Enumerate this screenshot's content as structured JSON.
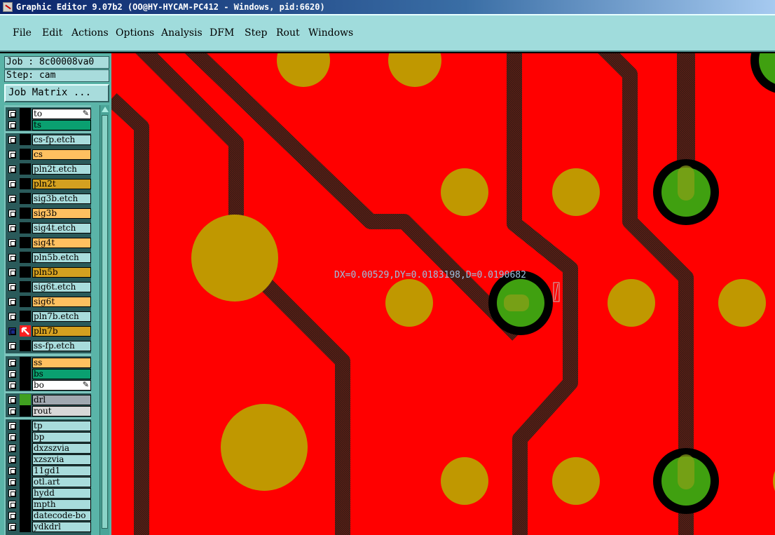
{
  "window": {
    "title": "Graphic Editor 9.07b2 (OO@HY-HYCAM-PC412 - Windows, pid:6620)"
  },
  "menu": [
    "File",
    "Edit",
    "Actions",
    "Options",
    "Analysis",
    "DFM",
    "Step",
    "Rout",
    "Windows"
  ],
  "panel": {
    "job": "Job : 8c00008va0",
    "step": "Step: cam",
    "job_matrix": "Job Matrix ..."
  },
  "layers": [
    {
      "name": "to",
      "color": "#ffffff",
      "swatch": "#000000",
      "editable_icon": true
    },
    {
      "name": "ts",
      "color": "#0aa070",
      "swatch": "#000000"
    },
    {
      "name": "cs-fp.etch",
      "color": "#a8dcdc",
      "swatch": "#000000"
    },
    {
      "name": "cs",
      "color": "#ffc060",
      "swatch": "#000000"
    },
    {
      "name": "pln2t.etch",
      "color": "#a8dcdc",
      "swatch": "#000000"
    },
    {
      "name": "pln2t",
      "color": "#d4a020",
      "swatch": "#000000"
    },
    {
      "name": "sig3b.etch",
      "color": "#a8dcdc",
      "swatch": "#000000"
    },
    {
      "name": "sig3b",
      "color": "#ffc060",
      "swatch": "#000000"
    },
    {
      "name": "sig4t.etch",
      "color": "#a8dcdc",
      "swatch": "#000000"
    },
    {
      "name": "sig4t",
      "color": "#ffc060",
      "swatch": "#000000"
    },
    {
      "name": "pln5b.etch",
      "color": "#a8dcdc",
      "swatch": "#000000"
    },
    {
      "name": "pln5b",
      "color": "#d4a020",
      "swatch": "#000000"
    },
    {
      "name": "sig6t.etch",
      "color": "#a8dcdc",
      "swatch": "#000000"
    },
    {
      "name": "sig6t",
      "color": "#ffc060",
      "swatch": "#000000"
    },
    {
      "name": "pln7b.etch",
      "color": "#a8dcdc",
      "swatch": "#000000"
    },
    {
      "name": "pln7b",
      "color": "#d4a020",
      "swatch": "#000000",
      "active": true
    },
    {
      "name": "ss-fp.etch",
      "color": "#a8dcdc",
      "swatch": "#000000"
    },
    {
      "name": "ss",
      "color": "#ffc060",
      "swatch": "#000000"
    },
    {
      "name": "bs",
      "color": "#0aa070",
      "swatch": "#000000"
    },
    {
      "name": "bo",
      "color": "#ffffff",
      "swatch": "#000000",
      "editable_icon": true
    },
    {
      "name": "drl",
      "color": "#a0a8b0",
      "swatch": "#40a020"
    },
    {
      "name": "rout",
      "color": "#d8d8d8",
      "swatch": "#000000"
    },
    {
      "name": "tp",
      "color": "#a8dcdc",
      "swatch": "#000000"
    },
    {
      "name": "bp",
      "color": "#a8dcdc",
      "swatch": "#000000"
    },
    {
      "name": "dxzszvia",
      "color": "#a8dcdc",
      "swatch": "#000000"
    },
    {
      "name": "xzszvia",
      "color": "#a8dcdc",
      "swatch": "#000000"
    },
    {
      "name": "11gd1",
      "color": "#a8dcdc",
      "swatch": "#000000"
    },
    {
      "name": "otl.art",
      "color": "#a8dcdc",
      "swatch": "#000000"
    },
    {
      "name": "hydd",
      "color": "#a8dcdc",
      "swatch": "#000000"
    },
    {
      "name": "mpth",
      "color": "#a8dcdc",
      "swatch": "#000000"
    },
    {
      "name": "datecode-bo",
      "color": "#a8dcdc",
      "swatch": "#000000"
    },
    {
      "name": "ydkdrl",
      "color": "#a8dcdc",
      "swatch": "#000000"
    }
  ],
  "pen_glyph": "✎",
  "canvas": {
    "measure_readout": "DX=0.00529,DY=0.0183198,D=0.0190682",
    "colors": {
      "board": "#ff0000",
      "pad": "#c09800",
      "drill": "#40a010",
      "trace": "#3a1a14"
    }
  }
}
